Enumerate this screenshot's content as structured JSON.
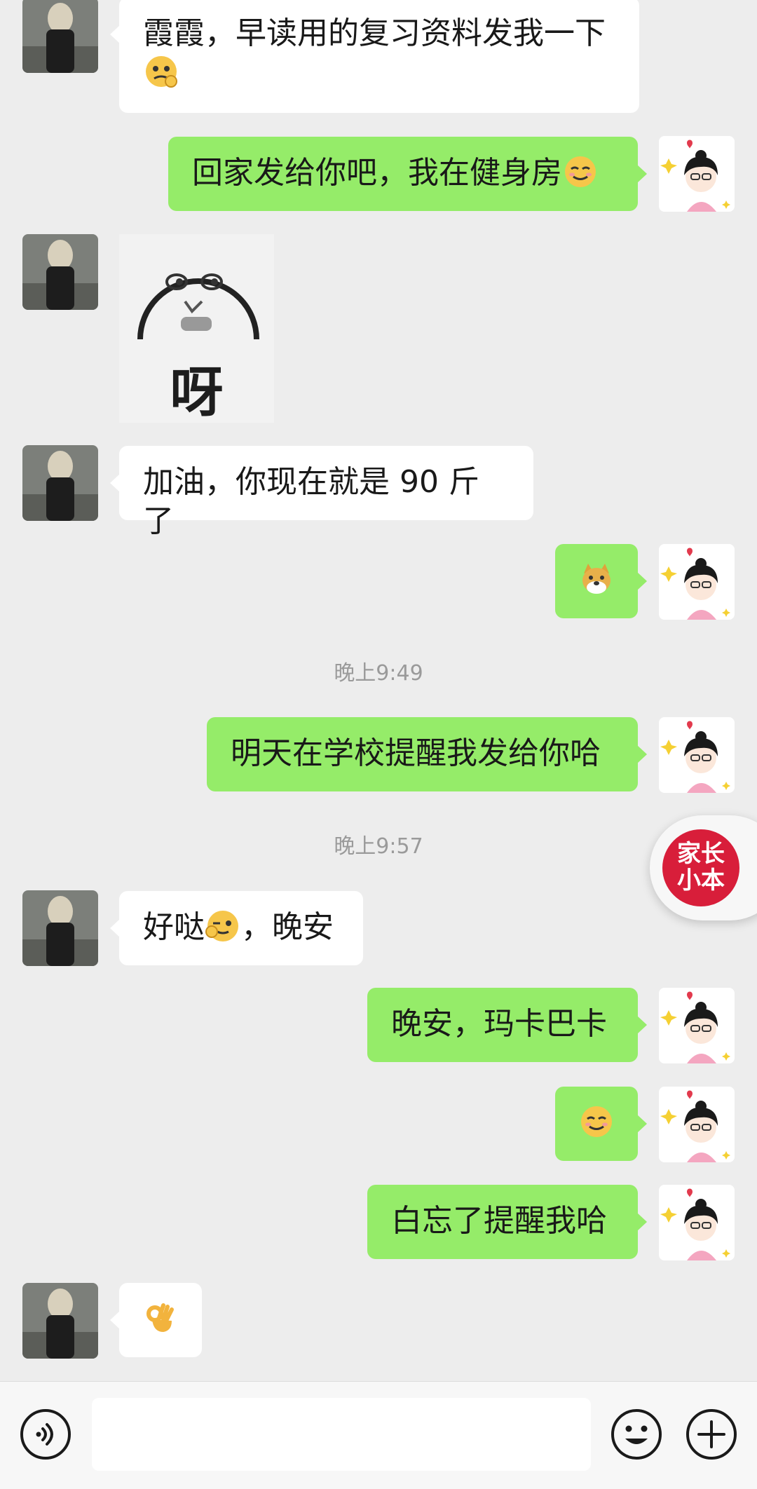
{
  "messages": {
    "m1": {
      "text": "霞霞，早读用的复习资料发我一下"
    },
    "m2": {
      "text": "回家发给你吧，我在健身房"
    },
    "m3": {
      "sticker_text": "呀"
    },
    "m4": {
      "text": "加油，你现在就是 90 斤了"
    },
    "m6": {
      "text": "明天在学校提醒我发给你哈"
    },
    "m7": {
      "text": "好哒",
      "text_after": "，晚安"
    },
    "m8": {
      "text": "晚安，玛卡巴卡"
    },
    "m10": {
      "text": "白忘了提醒我哈"
    },
    "m11": {
      "emoji": "ok-hand"
    }
  },
  "timestamps": {
    "t1": "晚上9:49",
    "t2": "晚上9:57"
  },
  "floating_button": {
    "line1": "家长",
    "line2": "小本"
  },
  "input": {
    "placeholder": ""
  },
  "colors": {
    "background": "#ededed",
    "bubble_self": "#95ec69",
    "bubble_other": "#ffffff",
    "float_logo": "#d81e3a"
  }
}
